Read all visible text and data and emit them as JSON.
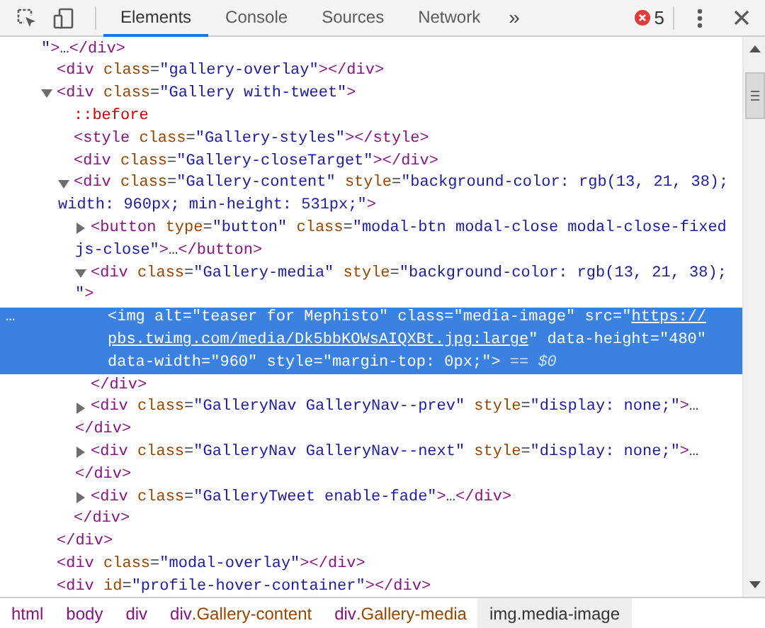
{
  "toolbar": {
    "tabs": [
      {
        "label": "Elements",
        "selected": true
      },
      {
        "label": "Console",
        "selected": false
      },
      {
        "label": "Sources",
        "selected": false
      },
      {
        "label": "Network",
        "selected": false
      }
    ],
    "more_tabs": "»",
    "error_count": "5"
  },
  "nodes": [
    {
      "kind": "continuation",
      "selected": false,
      "rows": [
        {
          "tokens": [
            {
              "kind": "value",
              "text": "\""
            },
            {
              "kind": "tag",
              "text": ">"
            },
            {
              "kind": "plain",
              "text": "…"
            },
            {
              "kind": "tag",
              "text": "</div>"
            }
          ]
        }
      ]
    },
    {
      "selected": false,
      "rows": [
        {
          "tokens": [
            {
              "kind": "tag",
              "text": "<div "
            },
            {
              "kind": "attr",
              "text": "class"
            },
            {
              "kind": "punct",
              "text": "="
            },
            {
              "kind": "value",
              "text": "\"gallery-overlay\""
            },
            {
              "kind": "tag",
              "text": "></div>"
            }
          ]
        }
      ]
    },
    {
      "selected": false,
      "expanded": true,
      "rows": [
        {
          "tokens": [
            {
              "kind": "tag",
              "text": "<div "
            },
            {
              "kind": "attr",
              "text": "class"
            },
            {
              "kind": "punct",
              "text": "="
            },
            {
              "kind": "value",
              "text": "\"Gallery with-tweet\""
            },
            {
              "kind": "tag",
              "text": ">"
            }
          ]
        }
      ],
      "closing": {
        "tokens": [
          {
            "kind": "tag",
            "text": "</div>"
          }
        ]
      },
      "children": [
        {
          "selected": false,
          "rows": [
            {
              "tokens": [
                {
                  "kind": "pseudo",
                  "text": "::before"
                }
              ]
            }
          ]
        },
        {
          "selected": false,
          "rows": [
            {
              "tokens": [
                {
                  "kind": "tag",
                  "text": "<style "
                },
                {
                  "kind": "attr",
                  "text": "class"
                },
                {
                  "kind": "punct",
                  "text": "="
                },
                {
                  "kind": "value",
                  "text": "\"Gallery-styles\""
                },
                {
                  "kind": "tag",
                  "text": "></style>"
                }
              ]
            }
          ]
        },
        {
          "selected": false,
          "rows": [
            {
              "tokens": [
                {
                  "kind": "tag",
                  "text": "<div "
                },
                {
                  "kind": "attr",
                  "text": "class"
                },
                {
                  "kind": "punct",
                  "text": "="
                },
                {
                  "kind": "value",
                  "text": "\"Gallery-closeTarget\""
                },
                {
                  "kind": "tag",
                  "text": "></div>"
                }
              ]
            }
          ]
        },
        {
          "selected": false,
          "expanded": true,
          "rows": [
            {
              "tokens": [
                {
                  "kind": "tag",
                  "text": "<div "
                },
                {
                  "kind": "attr",
                  "text": "class"
                },
                {
                  "kind": "punct",
                  "text": "="
                },
                {
                  "kind": "value",
                  "text": "\"Gallery-content\""
                },
                {
                  "kind": "attr",
                  "text": " style"
                },
                {
                  "kind": "punct",
                  "text": "="
                },
                {
                  "kind": "value",
                  "text": "\"background-color: rgb(13, 21, 38);"
                }
              ]
            },
            {
              "tokens": [
                {
                  "kind": "value",
                  "text": "width: 960px; min-height: 531px;\""
                },
                {
                  "kind": "tag",
                  "text": ">"
                }
              ]
            }
          ],
          "closing": {
            "tokens": [
              {
                "kind": "tag",
                "text": "</div>"
              }
            ]
          },
          "children": [
            {
              "selected": false,
              "expanded": false,
              "rows": [
                {
                  "tokens": [
                    {
                      "kind": "tag",
                      "text": "<button "
                    },
                    {
                      "kind": "attr",
                      "text": "type"
                    },
                    {
                      "kind": "punct",
                      "text": "="
                    },
                    {
                      "kind": "value",
                      "text": "\"button\""
                    },
                    {
                      "kind": "attr",
                      "text": " class"
                    },
                    {
                      "kind": "punct",
                      "text": "="
                    },
                    {
                      "kind": "value",
                      "text": "\"modal-btn modal-close modal-close-fixed"
                    }
                  ]
                },
                {
                  "tokens": [
                    {
                      "kind": "value",
                      "text": "js-close\""
                    },
                    {
                      "kind": "tag",
                      "text": ">"
                    },
                    {
                      "kind": "plain",
                      "text": "…"
                    },
                    {
                      "kind": "tag",
                      "text": "</button>"
                    }
                  ]
                }
              ]
            },
            {
              "selected": false,
              "expanded": true,
              "rows": [
                {
                  "tokens": [
                    {
                      "kind": "tag",
                      "text": "<div "
                    },
                    {
                      "kind": "attr",
                      "text": "class"
                    },
                    {
                      "kind": "punct",
                      "text": "="
                    },
                    {
                      "kind": "value",
                      "text": "\"Gallery-media\""
                    },
                    {
                      "kind": "attr",
                      "text": " style"
                    },
                    {
                      "kind": "punct",
                      "text": "="
                    },
                    {
                      "kind": "value",
                      "text": "\"background-color: rgb(13, 21, 38);"
                    }
                  ]
                },
                {
                  "tokens": [
                    {
                      "kind": "value",
                      "text": "\""
                    },
                    {
                      "kind": "tag",
                      "text": ">"
                    }
                  ]
                }
              ],
              "closing": {
                "tokens": [
                  {
                    "kind": "tag",
                    "text": "</div>"
                  }
                ]
              },
              "children": [
                {
                  "selected": true,
                  "gutter_marker": "…",
                  "rows": [
                    {
                      "tokens": [
                        {
                          "kind": "tag",
                          "text": "<img "
                        },
                        {
                          "kind": "attr",
                          "text": "alt"
                        },
                        {
                          "kind": "punct",
                          "text": "="
                        },
                        {
                          "kind": "value",
                          "text": "\"teaser for Mephisto\""
                        },
                        {
                          "kind": "attr",
                          "text": " class"
                        },
                        {
                          "kind": "punct",
                          "text": "="
                        },
                        {
                          "kind": "value",
                          "text": "\"media-image\""
                        },
                        {
                          "kind": "attr",
                          "text": " src"
                        },
                        {
                          "kind": "punct",
                          "text": "="
                        },
                        {
                          "kind": "value",
                          "text": "\""
                        },
                        {
                          "kind": "link",
                          "text": "https://"
                        }
                      ]
                    },
                    {
                      "tokens": [
                        {
                          "kind": "link",
                          "text": "pbs.twimg.com/media/Dk5bbKOWsAIQXBt.jpg:large"
                        },
                        {
                          "kind": "value",
                          "text": "\""
                        },
                        {
                          "kind": "attr",
                          "text": " data-height"
                        },
                        {
                          "kind": "punct",
                          "text": "="
                        },
                        {
                          "kind": "value",
                          "text": "\"480\""
                        }
                      ]
                    },
                    {
                      "tokens": [
                        {
                          "kind": "attr",
                          "text": "data-width"
                        },
                        {
                          "kind": "punct",
                          "text": "="
                        },
                        {
                          "kind": "value",
                          "text": "\"960\""
                        },
                        {
                          "kind": "attr",
                          "text": " style"
                        },
                        {
                          "kind": "punct",
                          "text": "="
                        },
                        {
                          "kind": "value",
                          "text": "\"margin-top: 0px;\""
                        },
                        {
                          "kind": "tag",
                          "text": ">"
                        },
                        {
                          "kind": "hint",
                          "text": " == $0"
                        }
                      ]
                    }
                  ]
                }
              ]
            },
            {
              "selected": false,
              "expanded": false,
              "rows": [
                {
                  "tokens": [
                    {
                      "kind": "tag",
                      "text": "<div "
                    },
                    {
                      "kind": "attr",
                      "text": "class"
                    },
                    {
                      "kind": "punct",
                      "text": "="
                    },
                    {
                      "kind": "value",
                      "text": "\"GalleryNav GalleryNav--prev\""
                    },
                    {
                      "kind": "attr",
                      "text": " style"
                    },
                    {
                      "kind": "punct",
                      "text": "="
                    },
                    {
                      "kind": "value",
                      "text": "\"display: none;\""
                    },
                    {
                      "kind": "tag",
                      "text": ">"
                    },
                    {
                      "kind": "plain",
                      "text": "…"
                    }
                  ]
                },
                {
                  "tokens": [
                    {
                      "kind": "tag",
                      "text": "</div>"
                    }
                  ]
                }
              ]
            },
            {
              "selected": false,
              "expanded": false,
              "rows": [
                {
                  "tokens": [
                    {
                      "kind": "tag",
                      "text": "<div "
                    },
                    {
                      "kind": "attr",
                      "text": "class"
                    },
                    {
                      "kind": "punct",
                      "text": "="
                    },
                    {
                      "kind": "value",
                      "text": "\"GalleryNav GalleryNav--next\""
                    },
                    {
                      "kind": "attr",
                      "text": " style"
                    },
                    {
                      "kind": "punct",
                      "text": "="
                    },
                    {
                      "kind": "value",
                      "text": "\"display: none;\""
                    },
                    {
                      "kind": "tag",
                      "text": ">"
                    },
                    {
                      "kind": "plain",
                      "text": "…"
                    }
                  ]
                },
                {
                  "tokens": [
                    {
                      "kind": "tag",
                      "text": "</div>"
                    }
                  ]
                }
              ]
            },
            {
              "selected": false,
              "expanded": false,
              "rows": [
                {
                  "tokens": [
                    {
                      "kind": "tag",
                      "text": "<div "
                    },
                    {
                      "kind": "attr",
                      "text": "class"
                    },
                    {
                      "kind": "punct",
                      "text": "="
                    },
                    {
                      "kind": "value",
                      "text": "\"GalleryTweet enable-fade\""
                    },
                    {
                      "kind": "tag",
                      "text": ">"
                    },
                    {
                      "kind": "plain",
                      "text": "…"
                    },
                    {
                      "kind": "tag",
                      "text": "</div>"
                    }
                  ]
                }
              ]
            }
          ]
        }
      ]
    },
    {
      "selected": false,
      "rows": [
        {
          "tokens": [
            {
              "kind": "tag",
              "text": "<div "
            },
            {
              "kind": "attr",
              "text": "class"
            },
            {
              "kind": "punct",
              "text": "="
            },
            {
              "kind": "value",
              "text": "\"modal-overlay\""
            },
            {
              "kind": "tag",
              "text": "></div>"
            }
          ]
        }
      ]
    },
    {
      "selected": false,
      "rows": [
        {
          "tokens": [
            {
              "kind": "tag",
              "text": "<div "
            },
            {
              "kind": "attr",
              "text": "id"
            },
            {
              "kind": "punct",
              "text": "="
            },
            {
              "kind": "value",
              "text": "\"profile-hover-container\""
            },
            {
              "kind": "tag",
              "text": "></div>"
            }
          ]
        }
      ]
    }
  ],
  "breadcrumbs": [
    {
      "tag": "html",
      "selected": false
    },
    {
      "tag": "body",
      "selected": false
    },
    {
      "tag": "div",
      "selected": false
    },
    {
      "tag": "div",
      "cls": ".Gallery-content",
      "selected": false
    },
    {
      "tag": "div",
      "cls": ".Gallery-media",
      "selected": false
    },
    {
      "tag": "img",
      "cls": ".media-image",
      "selected": true
    }
  ]
}
